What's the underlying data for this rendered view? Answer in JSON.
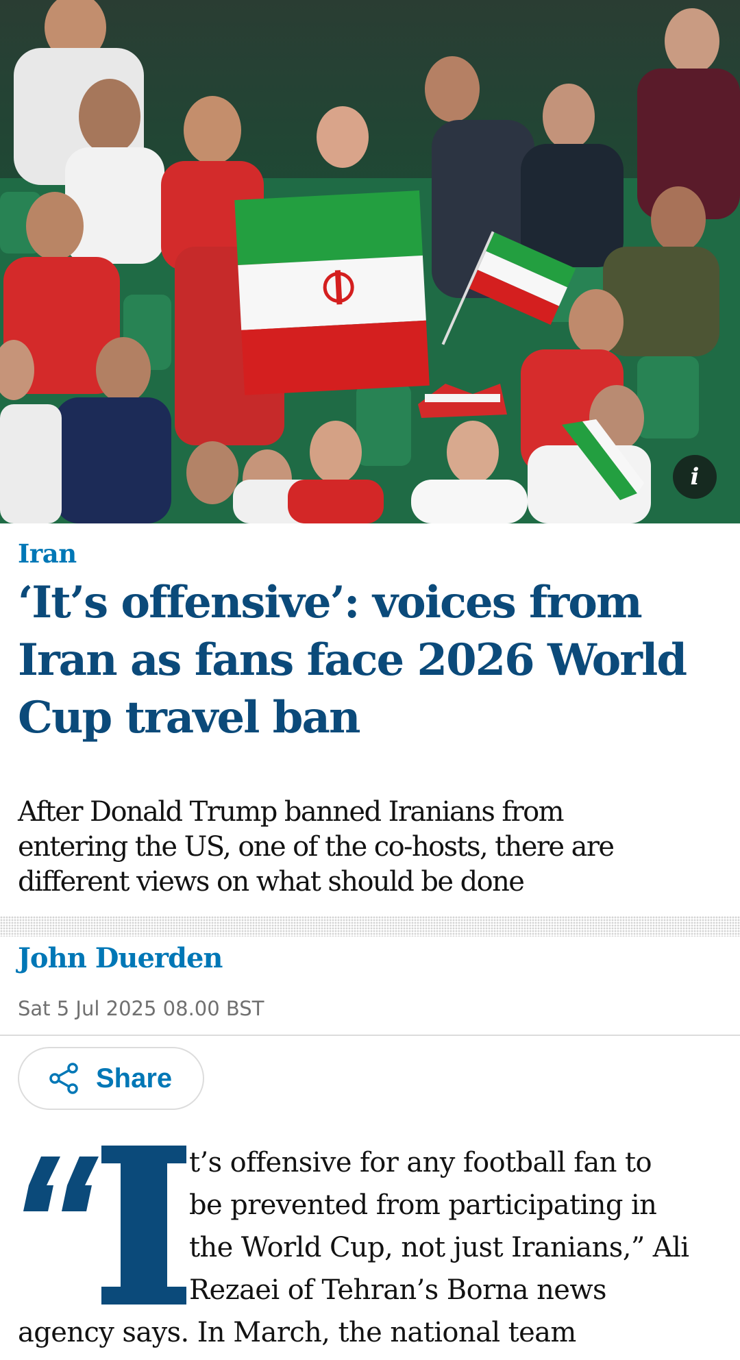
{
  "hero": {
    "info_label": "i",
    "flag_colors": {
      "green": "#239f40",
      "white": "#ffffff",
      "red": "#da0000"
    }
  },
  "article": {
    "kicker": "Iran",
    "headline_lines": [
      "‘It’s offensive’: voices from",
      "Iran as fans face 2026 World",
      "Cup travel ban"
    ],
    "standfirst_lines": [
      "After Donald Trump banned Iranians from",
      "entering the US, one of the co-hosts, there are",
      "different views on what should be done"
    ],
    "byline": "John Duerden",
    "date": "Sat 5 Jul 2025 08.00 BST",
    "share_label": "Share",
    "body_lines": [
      "t’s offensive for any football fan to",
      "be prevented from participating in",
      "the World Cup, not just Iranians,” Ali",
      "Rezaei of Tehran’s Borna news",
      "agency says. In March, the national team"
    ]
  },
  "colors": {
    "accent_blue": "#0077b6",
    "headline_navy": "#0b4a7a",
    "text": "#121212",
    "muted": "#707070"
  }
}
